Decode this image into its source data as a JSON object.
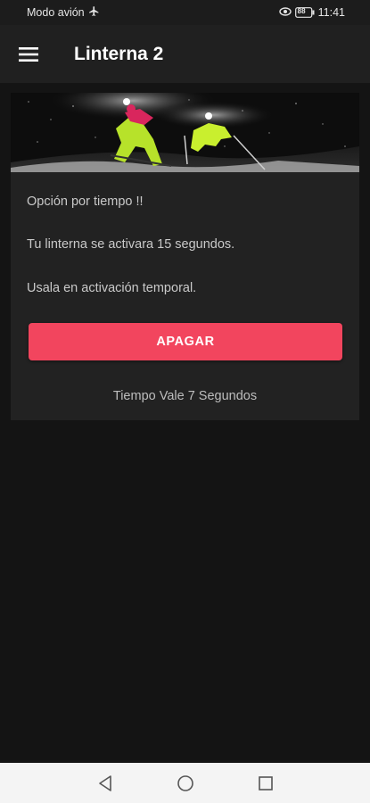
{
  "statusbar": {
    "airplane_text": "Modo avión",
    "time": "11:41",
    "battery_level": "88",
    "icons": [
      "airplane-icon",
      "eye-comfort-icon",
      "battery-icon"
    ]
  },
  "appbar": {
    "title": "Linterna 2",
    "menu_icon": "hamburger-menu-icon"
  },
  "card": {
    "image_icon": "night-skiers-image",
    "line1": "Opción por tiempo !!",
    "line2": "Tu linterna se activara 15 segundos.",
    "line3": "Usala en activación temporal.",
    "button_label": "APAGAR",
    "footer": "Tiempo Vale 7 Segundos"
  },
  "navbar": {
    "icons": [
      "back-triangle-icon",
      "home-circle-icon",
      "recents-square-icon"
    ]
  },
  "colors": {
    "background": "#141414",
    "appbar": "#202020",
    "card": "#222222",
    "accent": "#f2455e",
    "navbar": "#f4f4f4"
  }
}
